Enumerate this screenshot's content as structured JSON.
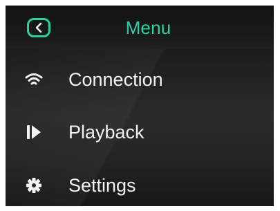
{
  "header": {
    "title": "Menu",
    "back_icon": "chevron-left-icon",
    "accent_color": "#27d3a2"
  },
  "menu": {
    "items": [
      {
        "label": "Connection",
        "icon": "wifi-icon"
      },
      {
        "label": "Playback",
        "icon": "play-icon"
      },
      {
        "label": "Settings",
        "icon": "gear-icon"
      }
    ]
  },
  "colors": {
    "background": "#1e1e1e",
    "text": "#f2f2f2",
    "accent": "#27d3a2"
  }
}
